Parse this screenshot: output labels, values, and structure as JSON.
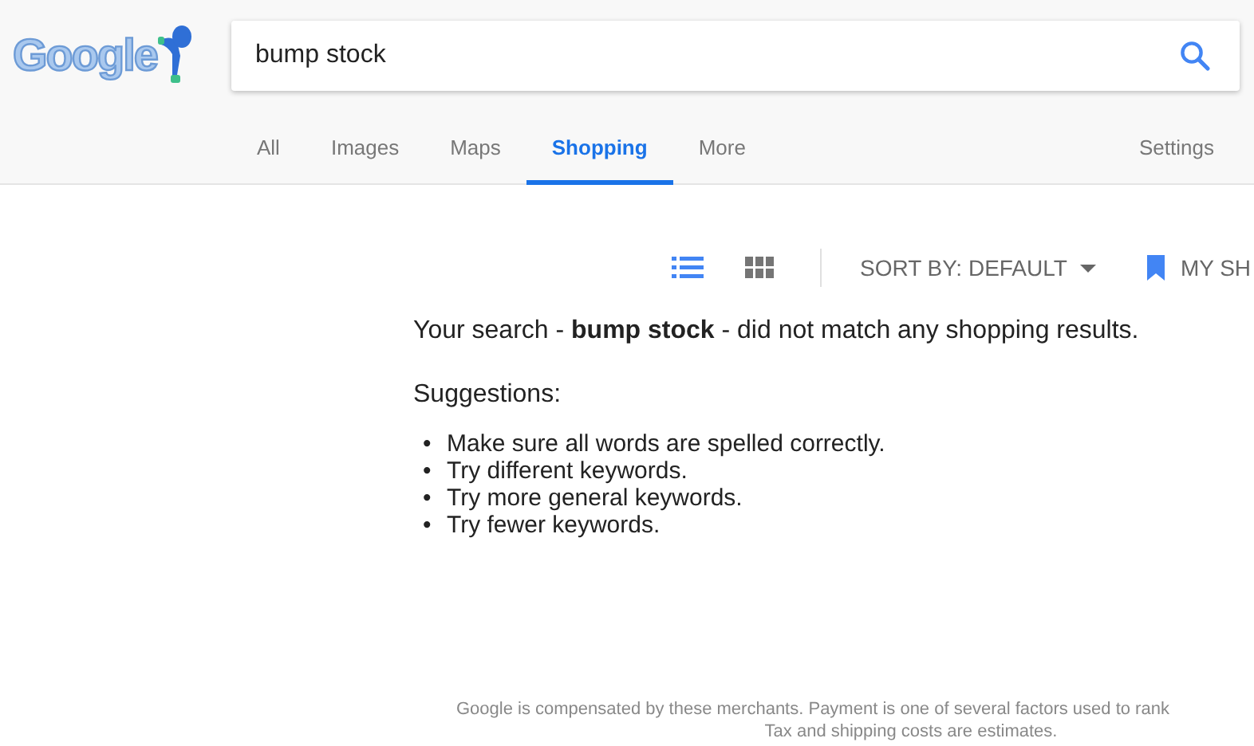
{
  "header": {
    "logo": "Google",
    "search": {
      "value": "bump stock"
    }
  },
  "tabs": [
    {
      "label": "All",
      "selected": false
    },
    {
      "label": "Images",
      "selected": false
    },
    {
      "label": "Maps",
      "selected": false
    },
    {
      "label": "Shopping",
      "selected": true
    },
    {
      "label": "More",
      "selected": false
    }
  ],
  "settings": "Settings",
  "toolbar": {
    "views": [
      {
        "kind": "list",
        "selected": true
      },
      {
        "kind": "grid",
        "selected": false
      }
    ],
    "sort": "SORT BY: DEFAULT",
    "my_shortlist": "MY SH"
  },
  "message": {
    "text": "Your search - **bump stock** - did not match any shopping results.",
    "suggestions_title": "Suggestions:",
    "suggestions": [
      {
        "marker": "•",
        "text": "Make sure all words are spelled correctly."
      },
      {
        "marker": "•",
        "text": "Try different keywords."
      },
      {
        "marker": "•",
        "text": "Try more general keywords."
      },
      {
        "marker": "•",
        "text": "Try fewer keywords."
      }
    ]
  },
  "footer": [
    "Google is compensated by these merchants. Payment is one of several factors used to rank",
    "Tax and shipping costs are estimates."
  ]
}
